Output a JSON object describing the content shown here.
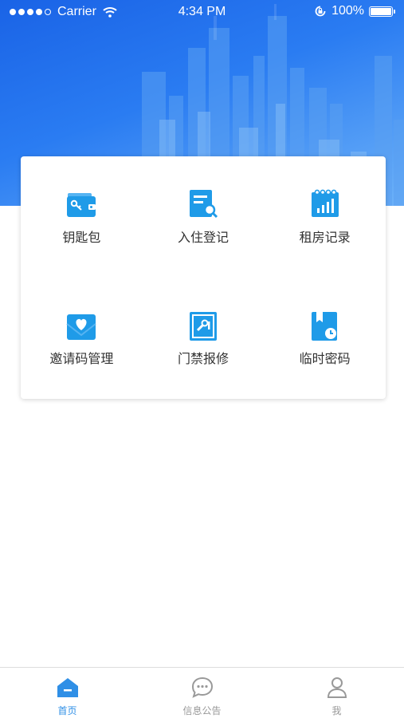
{
  "status_bar": {
    "carrier": "Carrier",
    "time": "4:34 PM",
    "battery": "100%",
    "battery_level": 1.0,
    "signal_bars_filled": 4,
    "signal_bars_total": 5
  },
  "theme": {
    "accent": "#2f8fe6",
    "icon_blue": "#1f9be8",
    "tab_inactive": "#999999"
  },
  "menu": {
    "items": [
      {
        "label": "钥匙包",
        "icon": "wallet-icon"
      },
      {
        "label": "入住登记",
        "icon": "document-search-icon"
      },
      {
        "label": "租房记录",
        "icon": "calendar-chart-icon"
      },
      {
        "label": "邀请码管理",
        "icon": "heart-envelope-icon"
      },
      {
        "label": "门禁报修",
        "icon": "door-tool-icon"
      },
      {
        "label": "临时密码",
        "icon": "book-clock-icon"
      }
    ]
  },
  "tab_bar": {
    "tabs": [
      {
        "label": "首页",
        "icon": "home-icon",
        "active": true
      },
      {
        "label": "信息公告",
        "icon": "chat-bubble-icon",
        "active": false
      },
      {
        "label": "我",
        "icon": "person-icon",
        "active": false
      }
    ]
  }
}
